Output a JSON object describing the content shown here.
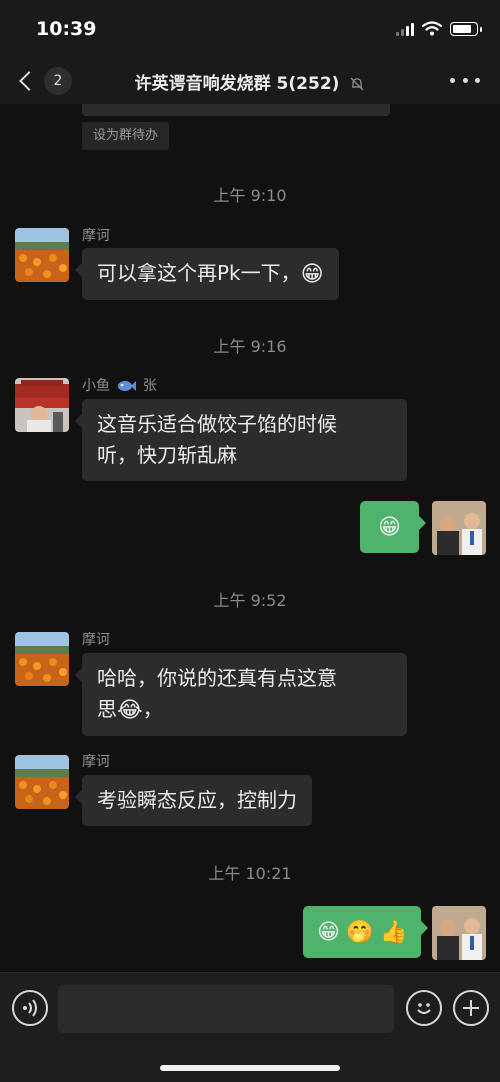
{
  "status_bar": {
    "time": "10:39"
  },
  "header": {
    "unread_count": "2",
    "title": "许英谔音响发烧群 5(252)"
  },
  "chat": {
    "todo_chip": "设为群待办",
    "messages": [
      {
        "kind": "time",
        "text": "上午 9:10"
      },
      {
        "kind": "incoming",
        "sender": "摩诃",
        "text": "可以拿这个再Pk一下，",
        "emoji": "😁"
      },
      {
        "kind": "time",
        "text": "上午 9:16"
      },
      {
        "kind": "incoming",
        "sender_name": "小鱼",
        "sender_suffix": "张",
        "line1": "这音乐适合做饺子馅的时候",
        "line2": "听，快刀斩乱麻"
      },
      {
        "kind": "outgoing",
        "emoji": "😁"
      },
      {
        "kind": "time",
        "text": "上午 9:52"
      },
      {
        "kind": "incoming",
        "sender": "摩诃",
        "line1": "哈哈，你说的还真有点这意",
        "line2_pre": "思",
        "emoji": "😂",
        "line2_post": "，"
      },
      {
        "kind": "incoming",
        "sender": "摩诃",
        "text": "考验瞬态反应，控制力"
      },
      {
        "kind": "time",
        "text": "上午 10:21"
      },
      {
        "kind": "outgoing",
        "emojis": [
          "😁",
          "🤭",
          "👍"
        ]
      }
    ]
  },
  "colors": {
    "background": "#111111",
    "bubble_in": "#2c2c2c",
    "bubble_out": "#4fb36c"
  },
  "icons": [
    "back-chevron-icon",
    "mute-bell-icon",
    "more-icon",
    "fish-icon",
    "voice-icon",
    "emoji-icon",
    "plus-icon"
  ]
}
